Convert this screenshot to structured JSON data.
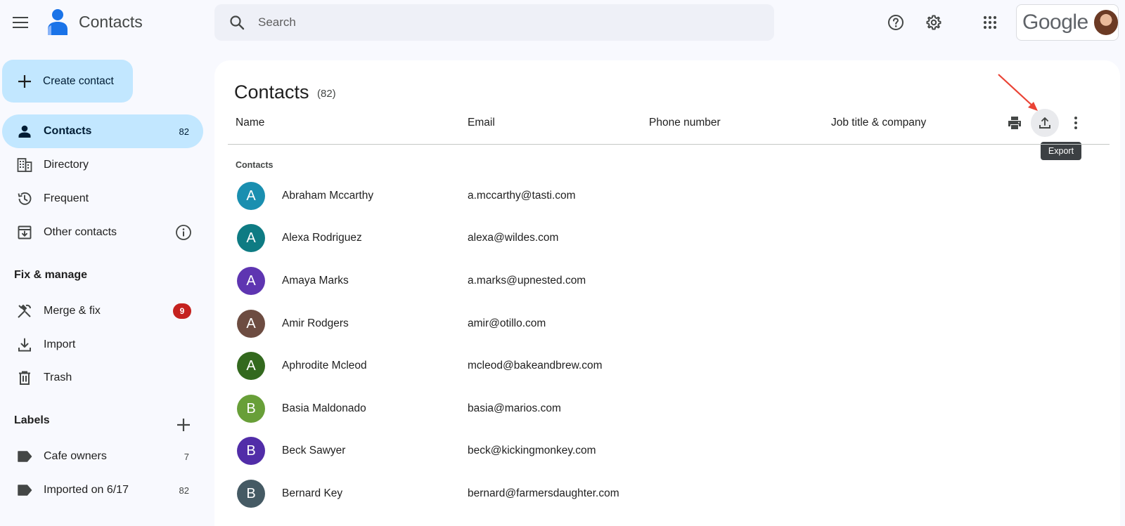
{
  "topbar": {
    "app_title": "Contacts",
    "search_placeholder": "Search",
    "google_label": "Google"
  },
  "sidebar": {
    "create_label": "Create contact",
    "items": [
      {
        "label": "Contacts",
        "count": "82",
        "icon": "person-icon"
      },
      {
        "label": "Directory",
        "icon": "building-icon"
      },
      {
        "label": "Frequent",
        "icon": "history-icon"
      },
      {
        "label": "Other contacts",
        "icon": "archive-icon"
      }
    ],
    "fix_title": "Fix & manage",
    "fix_items": [
      {
        "label": "Merge & fix",
        "badge": "9",
        "icon": "merge-fix-icon"
      },
      {
        "label": "Import",
        "icon": "download-icon"
      },
      {
        "label": "Trash",
        "icon": "trash-icon"
      }
    ],
    "labels_title": "Labels",
    "labels": [
      {
        "label": "Cafe owners",
        "count": "7"
      },
      {
        "label": "Imported on 6/17",
        "count": "82"
      }
    ]
  },
  "main": {
    "title": "Contacts",
    "count": "(82)",
    "columns": [
      "Name",
      "Email",
      "Phone number",
      "Job title & company"
    ],
    "tooltip": "Export",
    "group_label": "Contacts",
    "rows": [
      {
        "initial": "A",
        "name": "Abraham Mccarthy",
        "email": "a.mccarthy@tasti.com",
        "color": "#1a8fb0"
      },
      {
        "initial": "A",
        "name": "Alexa Rodriguez",
        "email": "alexa@wildes.com",
        "color": "#0e7b83"
      },
      {
        "initial": "A",
        "name": "Amaya Marks",
        "email": "a.marks@upnested.com",
        "color": "#5e35b1"
      },
      {
        "initial": "A",
        "name": "Amir Rodgers",
        "email": "amir@otillo.com",
        "color": "#6d4c41"
      },
      {
        "initial": "A",
        "name": "Aphrodite Mcleod",
        "email": "mcleod@bakeandbrew.com",
        "color": "#33691e"
      },
      {
        "initial": "B",
        "name": "Basia Maldonado",
        "email": "basia@marios.com",
        "color": "#689f38"
      },
      {
        "initial": "B",
        "name": "Beck Sawyer",
        "email": "beck@kickingmonkey.com",
        "color": "#512da8"
      },
      {
        "initial": "B",
        "name": "Bernard Key",
        "email": "bernard@farmersdaughter.com",
        "color": "#455a64"
      }
    ]
  },
  "colors": {
    "accent": "#c2e7ff",
    "badge": "#c5221f",
    "annotation_arrow": "#ea4335"
  }
}
